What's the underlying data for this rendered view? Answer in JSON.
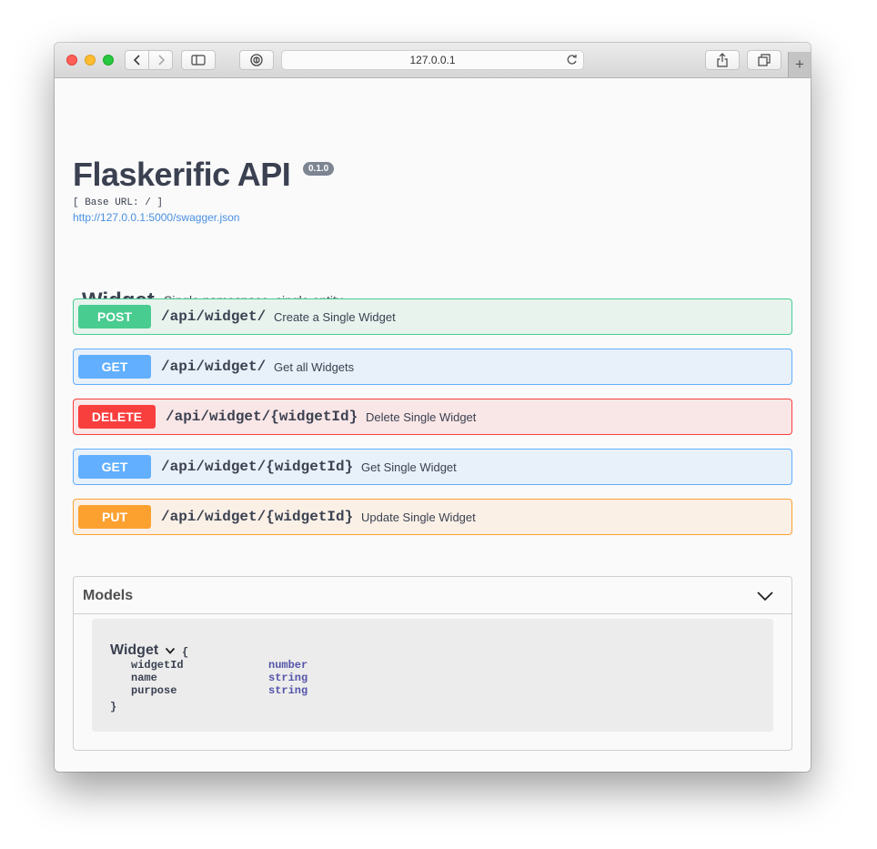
{
  "browser": {
    "address": "127.0.0.1"
  },
  "header": {
    "title": "Flaskerific API",
    "version": "0.1.0",
    "base_url": "[ Base URL: / ]",
    "spec_link": "http://127.0.0.1:5000/swagger.json"
  },
  "tag": {
    "name": "Widget",
    "description": "Single namespace, single entity"
  },
  "operations": [
    {
      "method": "POST",
      "path": "/api/widget/",
      "summary": "Create a Single Widget"
    },
    {
      "method": "GET",
      "path": "/api/widget/",
      "summary": "Get all Widgets"
    },
    {
      "method": "DELETE",
      "path": "/api/widget/{widgetId}",
      "summary": "Delete Single Widget"
    },
    {
      "method": "GET",
      "path": "/api/widget/{widgetId}",
      "summary": "Get Single Widget"
    },
    {
      "method": "PUT",
      "path": "/api/widget/{widgetId}",
      "summary": "Update Single Widget"
    }
  ],
  "models": {
    "title": "Models",
    "model": {
      "name": "Widget",
      "open_brace": "{",
      "close_brace": "}",
      "properties": [
        {
          "name": "widgetId",
          "type": "number"
        },
        {
          "name": "name",
          "type": "string"
        },
        {
          "name": "purpose",
          "type": "string"
        }
      ]
    }
  },
  "colors": {
    "post": "#49cc90",
    "get": "#61affe",
    "delete": "#f93e3e",
    "put": "#fca130",
    "link": "#4990e2"
  }
}
